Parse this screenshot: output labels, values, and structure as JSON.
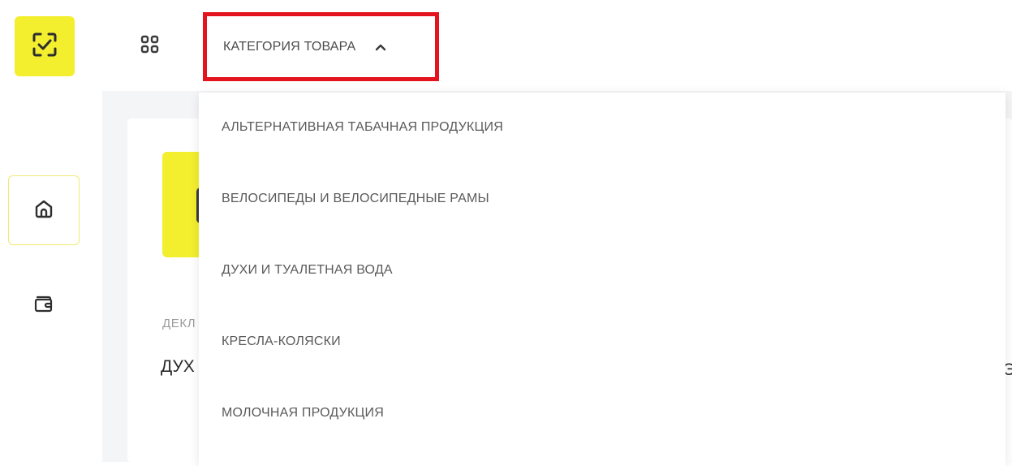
{
  "icons": {
    "logo": "scan-check-icon",
    "apps": "grid-icon",
    "home": "home-icon",
    "wallet": "wallet-icon",
    "chevron": "chevron-up-icon"
  },
  "colors": {
    "brand_yellow": "#f3ee2e",
    "highlight_red": "#e3141e"
  },
  "category_filter": {
    "label": "КАТЕГОРИЯ ТОВАРА"
  },
  "dropdown": {
    "items": [
      "АЛЬТЕРНАТИВНАЯ ТАБАЧНАЯ ПРОДУКЦИЯ",
      "ВЕЛОСИПЕДЫ И ВЕЛОСИПЕДНЫЕ РАМЫ",
      "ДУХИ И ТУАЛЕТНАЯ ВОДА",
      "КРЕСЛА-КОЛЯСКИ",
      "МОЛОЧНАЯ ПРОДУКЦИЯ"
    ]
  },
  "card": {
    "caption_partial": "ДЕКЛ",
    "title_partial": "ДУХ",
    "right_glyph": "Э"
  }
}
